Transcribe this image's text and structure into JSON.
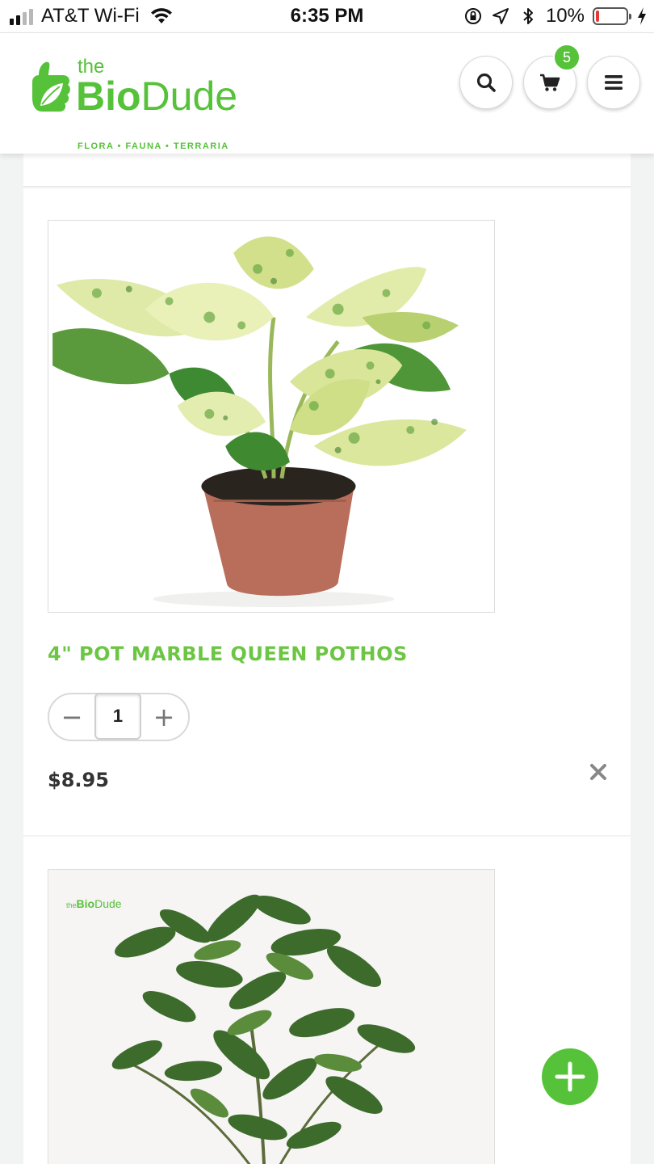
{
  "status_bar": {
    "carrier": "AT&T Wi-Fi",
    "time": "6:35 PM",
    "battery_percent": "10%",
    "battery_level": 0.1,
    "icons": [
      "signal-icon",
      "wifi-icon",
      "orientation-lock-icon",
      "location-icon",
      "bluetooth-icon",
      "battery-icon",
      "charging-icon"
    ]
  },
  "header": {
    "logo": {
      "the": "the",
      "bio": "Bio",
      "dude": "Dude",
      "tagline": "FLORA • FAUNA • TERRARIA"
    },
    "cart_count": "5",
    "icons": [
      "search-icon",
      "cart-icon",
      "menu-icon"
    ]
  },
  "cart": {
    "items": [
      {
        "title": "4\" POT MARBLE QUEEN POTHOS",
        "quantity": "1",
        "price": "$8.95",
        "decrement_label": "−",
        "increment_label": "+"
      },
      {
        "watermark_the": "the",
        "watermark_bio": "Bio",
        "watermark_dude": "Dude"
      }
    ]
  },
  "colors": {
    "brand_green": "#56c23a",
    "title_green": "#6cc644",
    "background": "#f2f3f3"
  }
}
